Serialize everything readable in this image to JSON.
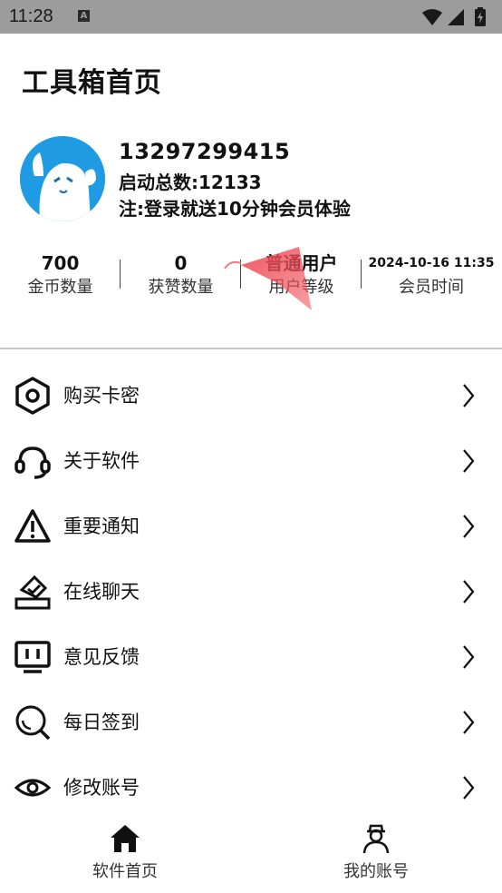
{
  "status_bar": {
    "time": "11:28",
    "notification_glyph": "A"
  },
  "page": {
    "title": "工具箱首页"
  },
  "profile": {
    "phone": "13297299415",
    "launch_count": "启动总数:12133",
    "note": "注:登录就送10分钟会员体验"
  },
  "stats": [
    {
      "value": "700",
      "label": "金币数量"
    },
    {
      "value": "0",
      "label": "获赞数量"
    },
    {
      "value": "普通用户",
      "label": "用户等级"
    },
    {
      "value": "2024-10-16 11:35",
      "label": "会员时间"
    }
  ],
  "menu": [
    {
      "label": "购买卡密",
      "icon": "hexagon-icon"
    },
    {
      "label": "关于软件",
      "icon": "headset-icon"
    },
    {
      "label": "重要通知",
      "icon": "warning-icon"
    },
    {
      "label": "在线聊天",
      "icon": "ballot-icon"
    },
    {
      "label": "意见反馈",
      "icon": "monitor-icon"
    },
    {
      "label": "每日签到",
      "icon": "search-icon"
    },
    {
      "label": "修改账号",
      "icon": "eye-icon"
    }
  ],
  "bottom_nav": [
    {
      "label": "软件首页",
      "icon": "home-icon"
    },
    {
      "label": "我的账号",
      "icon": "user-icon"
    }
  ],
  "colors": {
    "status_bar": "#9c9c9c",
    "avatar_bg": "#1e9be2",
    "pointer": "#f04f5a"
  }
}
